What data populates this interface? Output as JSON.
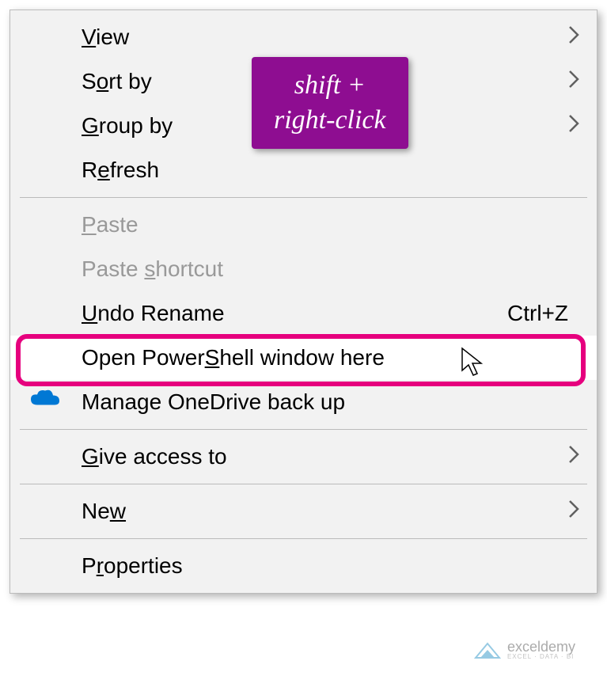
{
  "menu": {
    "view": {
      "prefix": "",
      "u": "V",
      "rest": "iew"
    },
    "sortby": {
      "prefix": "S",
      "u": "o",
      "rest": "rt by"
    },
    "groupby": {
      "prefix": "",
      "u": "G",
      "rest": "roup by"
    },
    "refresh": {
      "prefix": "R",
      "u": "e",
      "rest": "fresh"
    },
    "paste": {
      "prefix": "",
      "u": "P",
      "rest": "aste"
    },
    "pasteshortcut": {
      "prefix": "Paste ",
      "u": "s",
      "rest": "hortcut"
    },
    "undo": {
      "prefix": "",
      "u": "U",
      "rest": "ndo Rename"
    },
    "undoshortcut": "Ctrl+Z",
    "powershell": {
      "prefix": "Open Power",
      "u": "S",
      "rest": "hell window here"
    },
    "onedrive": {
      "prefix": "Manage OneDrive back up",
      "u": "",
      "rest": ""
    },
    "giveaccess": {
      "prefix": "",
      "u": "G",
      "rest": "ive access to"
    },
    "new": {
      "prefix": "Ne",
      "u": "w",
      "rest": ""
    },
    "properties": {
      "prefix": "P",
      "u": "r",
      "rest": "operties"
    }
  },
  "callout": {
    "line1": "shift +",
    "line2": "right-click"
  },
  "watermark": {
    "main": "exceldemy",
    "sub": "EXCEL · DATA · BI"
  }
}
